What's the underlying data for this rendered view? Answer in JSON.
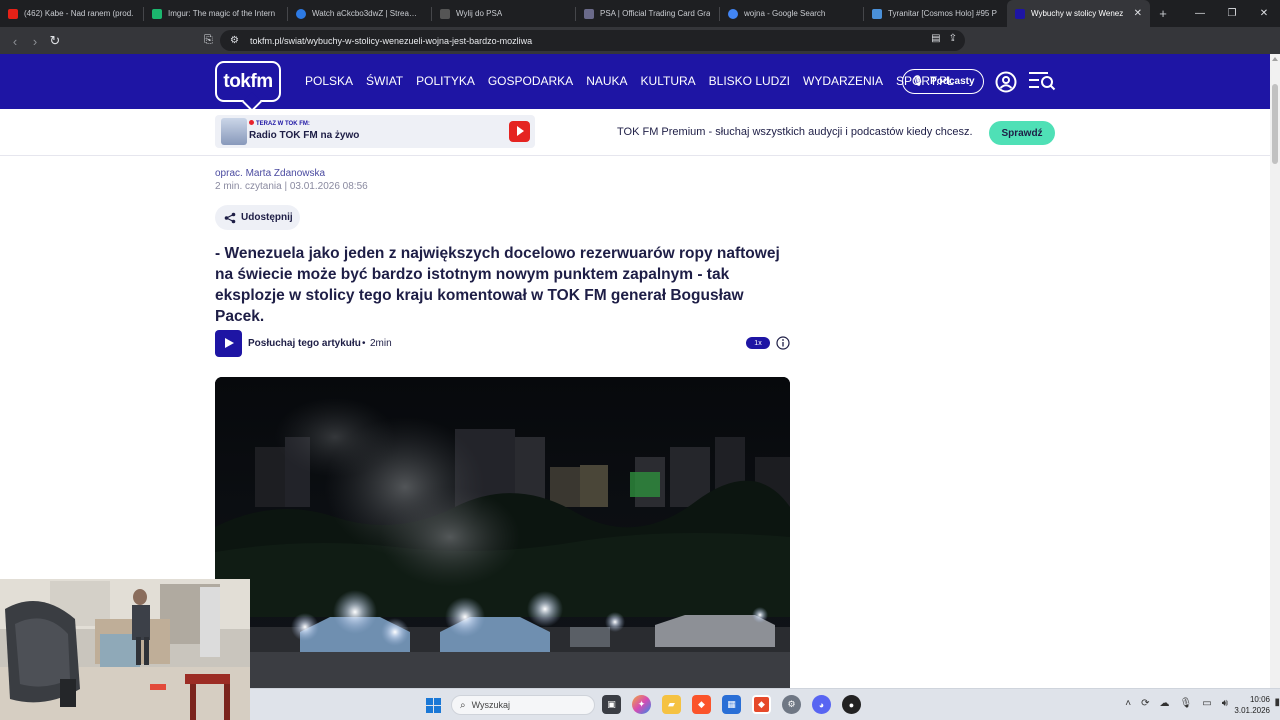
{
  "browser": {
    "tabs": [
      {
        "title": "(462) Kabe - Nad ranem (prod.",
        "color": "#e62117"
      },
      {
        "title": "Imgur: The magic of the Intern",
        "color": "#1bb76e"
      },
      {
        "title": "Watch aCkcbo3dwZ | Streamab",
        "color": "#2d7ae4"
      },
      {
        "title": "Wylij do PSA",
        "color": "#555555"
      },
      {
        "title": "PSA | Official Trading Card Gra",
        "color": "#6a6a8a"
      },
      {
        "title": "wojna - Google Search",
        "color": "#4285f4"
      },
      {
        "title": "Tyranitar [Cosmos Holo] #95 P",
        "color": "#4a90d9"
      },
      {
        "title": "Wybuchy w stolicy Wenez",
        "color": "#1e15a4"
      }
    ],
    "new_tab_symbol": "+",
    "url": "tokfm.pl/swiat/wybuchy-w-stolicy-wenezueli-wojna-jest-bardzo-mozliwa",
    "brave_badge_count": "1"
  },
  "site": {
    "logo": "tokfm",
    "nav": [
      "POLSKA",
      "ŚWIAT",
      "POLITYKA",
      "GOSPODARKA",
      "NAUKA",
      "KULTURA",
      "BLISKO LUDZI",
      "WYDARZENIA",
      "SPORT.PL"
    ],
    "podcasts_label": "Podcasty",
    "brand_color": "#1e15a4"
  },
  "promo": {
    "live_label": "TERAZ W TOK FM:",
    "radio_label": "Radio TOK FM na żywo",
    "premium_text": "TOK FM Premium - słuchaj wszystkich audycji i podcastów kiedy chcesz.",
    "cta_label": "Sprawdź",
    "cta_color": "#4fe0b6"
  },
  "article": {
    "byline": "oprac. Marta Zdanowska",
    "meta": "2 min. czytania | 03.01.2026 08:56",
    "share_label": "Udostępnij",
    "lead": "- Wenezuela jako jeden z największych docelowo rezerwuarów ropy naftowej na świecie może być bardzo istotnym nowym punktem zapalnym - tak eksplozje w stolicy tego kraju komentował w TOK FM generał Bogusław Pacek.",
    "player_label": "Posłuchaj tego artykułu",
    "player_separator": "•",
    "player_duration": "2min",
    "speed_label": "1x"
  },
  "taskbar": {
    "search_placeholder": "Wyszukaj",
    "time": "10:06",
    "date": "3.01.2026"
  }
}
